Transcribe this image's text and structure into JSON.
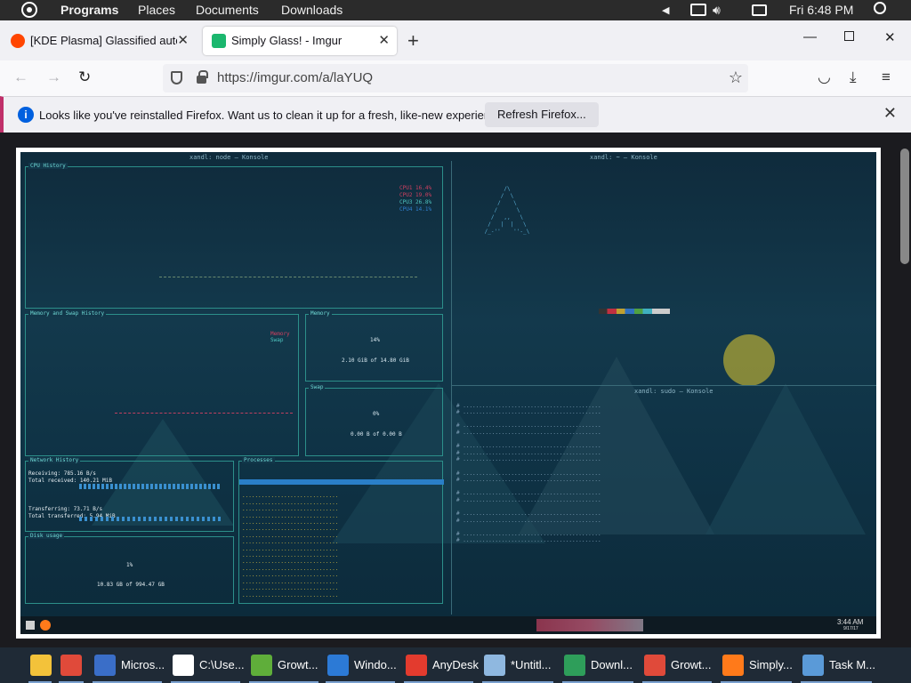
{
  "topbar": {
    "programs": "Programs",
    "places": "Places",
    "documents": "Documents",
    "downloads": "Downloads",
    "clock": "Fri 6:48 PM"
  },
  "tabs": [
    {
      "title": "[KDE Plasma] Glassified autohid",
      "active": false,
      "favicon_color": "#ff4500"
    },
    {
      "title": "Simply Glass! - Imgur",
      "active": true,
      "favicon_color": "#1bb76e"
    }
  ],
  "navbar": {
    "url": "https://imgur.com/a/laYUQ"
  },
  "notification": {
    "message": "Looks like you've reinstalled Firefox. Want us to clean it up for a fresh, like-new experience?",
    "button": "Refresh Firefox..."
  },
  "screenshot": {
    "left_window_title": "xandl: node — Konsole",
    "right_window_title": "xandl: ~ — Konsole",
    "bottom_window_title": "xandl: sudo — Konsole",
    "cpu_history": "CPU History",
    "memory_swap_history": "Memory and Swap History",
    "memory": "Memory",
    "memory_pct": "14%",
    "memory_usage": "2.10 GiB of 14.80 GiB",
    "swap": "Swap",
    "swap_pct": "0%",
    "swap_usage": "0.00 B of 0.00 B",
    "network_history": "Network History",
    "receiving": "Receiving:",
    "receiving_val": "785.16  B/s",
    "total_received": "Total received:",
    "total_received_val": "140.21 MiB",
    "transferring": "Transferring:",
    "transferring_val": "73.71  B/s",
    "total_transferred": "Total transferred:",
    "total_transferred_val": "5.94 MiB",
    "processes": "Processes",
    "disk_usage": "Disk usage",
    "disk_pct": "1%",
    "disk_val": "10.83 GB of 994.47 GB",
    "kde_clock_time": "3:44 AM",
    "kde_clock_date": "9/17/17"
  },
  "taskbar": [
    {
      "label": "",
      "icon": "file-explorer-icon",
      "color": "#f3c23a"
    },
    {
      "label": "",
      "icon": "chrome-icon",
      "color": "#e04a3a"
    },
    {
      "label": "Micros...",
      "icon": "solitaire-icon",
      "color": "#3a6ec8"
    },
    {
      "label": "C:\\Use...",
      "icon": "7zip-icon",
      "color": "#ffffff"
    },
    {
      "label": "Growt...",
      "icon": "growtopia-icon",
      "color": "#5fae3a"
    },
    {
      "label": "Windo...",
      "icon": "windows-security-icon",
      "color": "#2c7ad6"
    },
    {
      "label": "AnyDesk",
      "icon": "anydesk-icon",
      "color": "#e33b2e"
    },
    {
      "label": "*Untitl...",
      "icon": "notepad-icon",
      "color": "#8fb8e0"
    },
    {
      "label": "Downl...",
      "icon": "downloads-icon",
      "color": "#2e9e5a"
    },
    {
      "label": "Growt...",
      "icon": "chrome-icon",
      "color": "#e04a3a"
    },
    {
      "label": "Simply...",
      "icon": "firefox-icon",
      "color": "#ff7a1a"
    },
    {
      "label": "Task M...",
      "icon": "task-manager-icon",
      "color": "#5a9ad8"
    }
  ]
}
